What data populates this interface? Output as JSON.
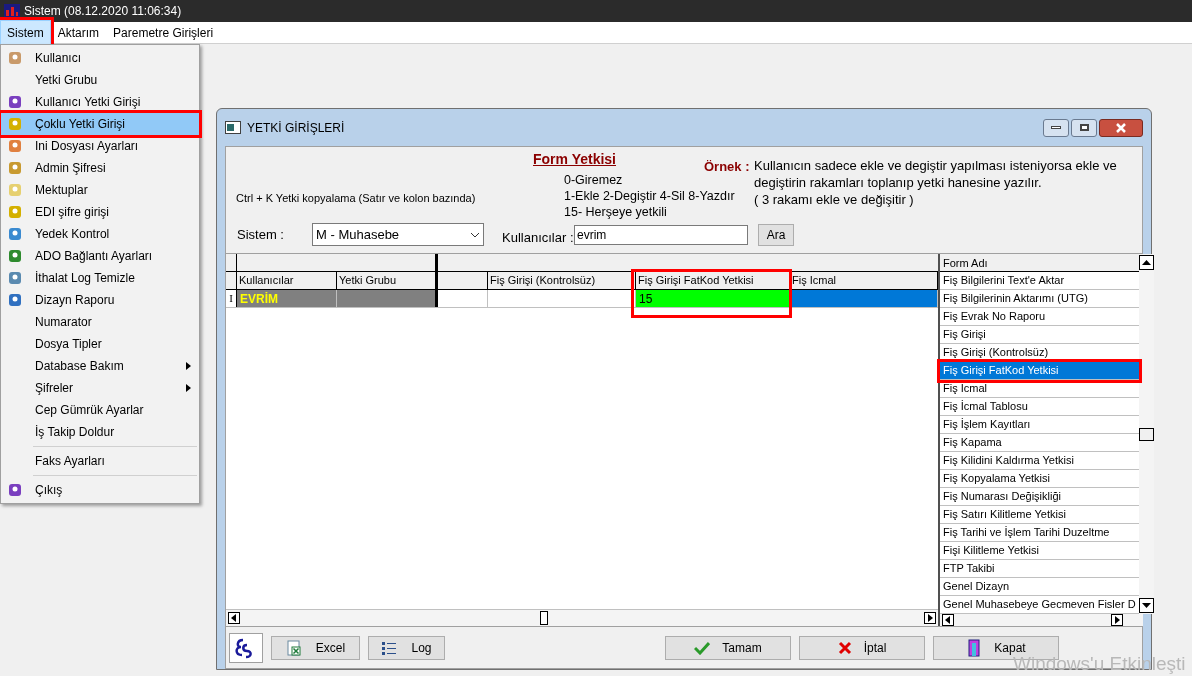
{
  "title_bar": {
    "title": "Sistem (08.12.2020 11:06:34)"
  },
  "menu_bar": [
    {
      "label": "Sistem",
      "selected": true,
      "annotated": true
    },
    {
      "label": "Aktarım",
      "selected": false,
      "annotated": false
    },
    {
      "label": "Paremetre Girişleri",
      "selected": false,
      "annotated": false
    }
  ],
  "dropdown": [
    {
      "label": "Kullanıcı",
      "selected": false,
      "annotated": false,
      "submenu": false,
      "separator_before": false
    },
    {
      "label": "Yetki Grubu",
      "selected": false,
      "annotated": false,
      "submenu": false,
      "separator_before": false
    },
    {
      "label": "Kullanıcı Yetki Girişi",
      "selected": false,
      "annotated": false,
      "submenu": false,
      "separator_before": false
    },
    {
      "label": "Çoklu Yetki Girişi",
      "selected": true,
      "annotated": true,
      "submenu": false,
      "separator_before": false
    },
    {
      "label": "Ini Dosyası  Ayarları",
      "selected": false,
      "annotated": false,
      "submenu": false,
      "separator_before": false
    },
    {
      "label": "Admin Şifresi",
      "selected": false,
      "annotated": false,
      "submenu": false,
      "separator_before": false
    },
    {
      "label": "Mektuplar",
      "selected": false,
      "annotated": false,
      "submenu": false,
      "separator_before": false
    },
    {
      "label": "EDI şifre girişi",
      "selected": false,
      "annotated": false,
      "submenu": false,
      "separator_before": false
    },
    {
      "label": "Yedek Kontrol",
      "selected": false,
      "annotated": false,
      "submenu": false,
      "separator_before": false
    },
    {
      "label": "ADO Bağlantı Ayarları",
      "selected": false,
      "annotated": false,
      "submenu": false,
      "separator_before": false
    },
    {
      "label": "İthalat Log Temizle",
      "selected": false,
      "annotated": false,
      "submenu": false,
      "separator_before": false
    },
    {
      "label": "Dizayn Raporu",
      "selected": false,
      "annotated": false,
      "submenu": false,
      "separator_before": false
    },
    {
      "label": "Numarator",
      "selected": false,
      "annotated": false,
      "submenu": false,
      "separator_before": false
    },
    {
      "label": "Dosya Tipler",
      "selected": false,
      "annotated": false,
      "submenu": false,
      "separator_before": false
    },
    {
      "label": "Database Bakım",
      "selected": false,
      "annotated": false,
      "submenu": true,
      "separator_before": false
    },
    {
      "label": "Şifreler",
      "selected": false,
      "annotated": false,
      "submenu": true,
      "separator_before": false
    },
    {
      "label": "Cep Gümrük Ayarlar",
      "selected": false,
      "annotated": false,
      "submenu": false,
      "separator_before": false
    },
    {
      "label": "İş Takip Doldur",
      "selected": false,
      "annotated": false,
      "submenu": false,
      "separator_before": false
    },
    {
      "label": "Faks Ayarları",
      "selected": false,
      "annotated": false,
      "submenu": false,
      "separator_before": true
    },
    {
      "label": "Çıkış",
      "selected": false,
      "annotated": false,
      "submenu": false,
      "separator_before": true
    }
  ],
  "dialog": {
    "title": "YETKİ GİRİŞLERİ",
    "form_heading": "Form Yetkisi",
    "codes": [
      "0-Giremez",
      "1-Ekle  2-Degiştir  4-Sil  8-Yazdır",
      "15- Herşeye yetkili"
    ],
    "example_label": "Örnek :",
    "example_lines": [
      "Kullanıcın sadece ekle ve degiştir yapılması isteniyorsa  ekle ve",
      "degiştirin rakamları toplanıp yetki hanesine yazılır.",
      "( 3 rakamı ekle ve değişitir )"
    ],
    "copy_hint": "Ctrl + K Yetki kopyalama (Satır ve kolon bazında)",
    "system_label": "Sistem :",
    "system_value": "M - Muhasebe",
    "users_label": "Kullanıcılar :",
    "users_value": "evrim",
    "search_button": "Ara",
    "columns": [
      {
        "label": "Kullanıcılar",
        "annotated": false
      },
      {
        "label": "Yetki Grubu",
        "annotated": false
      },
      {
        "annotated": false
      },
      {
        "label": "Fiş Girişi (Kontrolsüz)",
        "annotated": false
      },
      {
        "label": "Fiş Girişi FatKod Yetkisi",
        "annotated": true
      },
      {
        "label": "Fiş Icmal",
        "annotated": false
      }
    ],
    "rows": [
      {
        "marker": "I",
        "cells": [
          {
            "text": "EVRİM",
            "color": "#808080"
          },
          {
            "text": "",
            "color": "#808080"
          },
          {
            "text": "",
            "color": "#ffffff"
          },
          {
            "text": "",
            "color": "#ffffff"
          },
          {
            "text": "15",
            "color": "#00ff00"
          },
          {
            "text": "",
            "color": "#0078d7"
          }
        ]
      }
    ],
    "list_header": "Form Adı",
    "list": [
      {
        "label": "Fiş Bilgilerini Text'e Aktar",
        "selected": false,
        "annotated": false
      },
      {
        "label": "Fiş Bilgilerinin Aktarımı (UTG)",
        "selected": false,
        "annotated": false
      },
      {
        "label": "Fiş Evrak No Raporu",
        "selected": false,
        "annotated": false
      },
      {
        "label": "Fiş Girişi",
        "selected": false,
        "annotated": false
      },
      {
        "label": "Fiş Girişi (Kontrolsüz)",
        "selected": false,
        "annotated": false
      },
      {
        "label": "Fiş Girişi FatKod Yetkisi",
        "selected": true,
        "annotated": true
      },
      {
        "label": "Fiş Icmal",
        "selected": false,
        "annotated": false
      },
      {
        "label": "Fiş İcmal Tablosu",
        "selected": false,
        "annotated": false
      },
      {
        "label": "Fiş İşlem Kayıtları",
        "selected": false,
        "annotated": false
      },
      {
        "label": "Fiş Kapama",
        "selected": false,
        "annotated": false
      },
      {
        "label": "Fiş Kilidini Kaldırma Yetkisi",
        "selected": false,
        "annotated": false
      },
      {
        "label": "Fiş Kopyalama Yetkisi",
        "selected": false,
        "annotated": false
      },
      {
        "label": "Fiş Numarası Değişikliği",
        "selected": false,
        "annotated": false
      },
      {
        "label": "Fiş Satırı Kilitleme Yetkisi",
        "selected": false,
        "annotated": false
      },
      {
        "label": "Fiş Tarihi ve İşlem Tarihi Duzeltme",
        "selected": false,
        "annotated": false
      },
      {
        "label": "Fişi Kilitleme Yetkisi",
        "selected": false,
        "annotated": false
      },
      {
        "label": "FTP Takibi",
        "selected": false,
        "annotated": false
      },
      {
        "label": "Genel Dizayn",
        "selected": false,
        "annotated": false
      },
      {
        "label": "Genel Muhasebeye Gecmeven Fisler D",
        "selected": false,
        "annotated": false
      }
    ],
    "left_buttons": [
      {
        "label": "Excel",
        "kind": "excel"
      },
      {
        "label": "Log",
        "kind": "log"
      }
    ],
    "right_buttons": [
      {
        "label": "Tamam",
        "kind": "ok"
      },
      {
        "label": "İptal",
        "kind": "cancel"
      },
      {
        "label": "Kapat",
        "kind": "close"
      }
    ]
  },
  "activation_notice": "Windows'u Etkinleşti"
}
